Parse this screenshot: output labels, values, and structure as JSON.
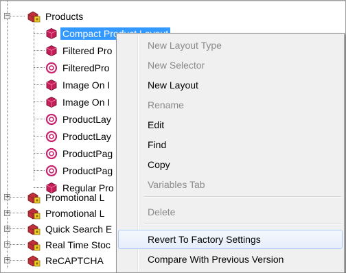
{
  "tree": {
    "root": {
      "label": "Products",
      "expander": "−",
      "icon": "package-icon"
    },
    "children": [
      {
        "label": "Compact Product Layout",
        "icon": "layout-icon",
        "selected": true
      },
      {
        "label": "Filtered Pro",
        "icon": "layout-icon"
      },
      {
        "label": "FilteredPro",
        "icon": "selector-icon"
      },
      {
        "label": "Image On I",
        "icon": "layout-icon"
      },
      {
        "label": "Image On I",
        "icon": "layout-icon"
      },
      {
        "label": "ProductLay",
        "icon": "selector-icon"
      },
      {
        "label": "ProductLay",
        "icon": "selector-icon"
      },
      {
        "label": "ProductPag",
        "icon": "selector-icon"
      },
      {
        "label": "ProductPag",
        "icon": "selector-icon"
      },
      {
        "label": "Regular Pro",
        "icon": "layout-icon"
      }
    ],
    "siblings": [
      {
        "label": "Promotional L",
        "expander": "+",
        "icon": "package-icon"
      },
      {
        "label": "Promotional L",
        "expander": "+",
        "icon": "package-icon"
      },
      {
        "label": "Quick Search E",
        "expander": "+",
        "icon": "package-icon"
      },
      {
        "label": "Real Time Stoc",
        "expander": "+",
        "icon": "package-icon"
      },
      {
        "label": "ReCAPTCHA",
        "expander": "+",
        "icon": "package-icon"
      }
    ]
  },
  "context_menu": {
    "items": [
      {
        "label": "New Layout Type",
        "disabled": true
      },
      {
        "label": "New Selector",
        "disabled": true
      },
      {
        "label": "New Layout",
        "disabled": false
      },
      {
        "label": "Rename",
        "disabled": true
      },
      {
        "label": "Edit",
        "disabled": false
      },
      {
        "label": "Find",
        "disabled": false
      },
      {
        "label": "Copy",
        "disabled": false
      },
      {
        "label": "Variables Tab",
        "disabled": true
      },
      {
        "label": "Delete",
        "disabled": true
      },
      {
        "label": "Revert To Factory Settings",
        "disabled": false,
        "highlighted": true
      },
      {
        "label": "Compare With Previous Version",
        "disabled": false
      }
    ]
  },
  "colors": {
    "package_icon": "#c0303a",
    "package_badge": "#f2d22e",
    "layout_icon": "#c41e5a",
    "selector_icon": "#c8226e",
    "selection": "#3399ff",
    "menu_bg": "#f0f0f0"
  }
}
